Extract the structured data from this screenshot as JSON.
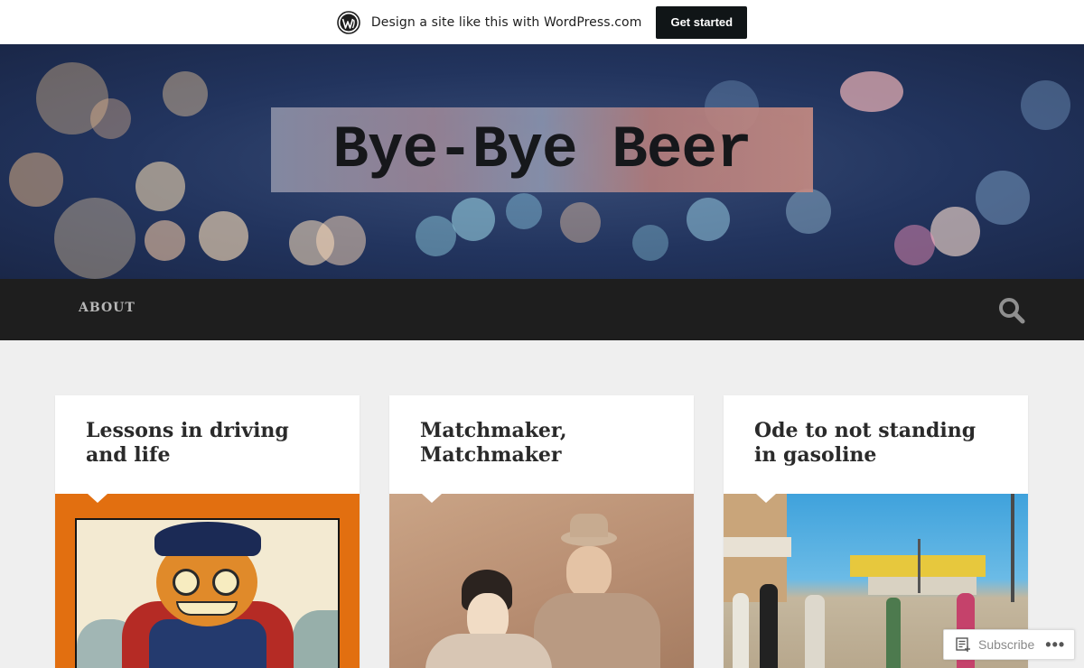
{
  "promo": {
    "text": "Design a site like this with WordPress.com",
    "button_label": "Get started"
  },
  "site": {
    "title": "Bye-Bye Beer"
  },
  "nav": {
    "about_label": "ABOUT"
  },
  "posts": [
    {
      "title": "Lessons in driving and life"
    },
    {
      "title": "Matchmaker, Matchmaker"
    },
    {
      "title": "Ode to not standing in gasoline"
    }
  ],
  "subscribe": {
    "label": "Subscribe",
    "more_label": "•••"
  },
  "colors": {
    "nav_bg": "#1e1e1e",
    "page_bg": "#efefef",
    "promo_button": "#101517"
  },
  "icons": [
    "wordpress-logo-icon",
    "search-icon",
    "subscribe-icon",
    "more-icon"
  ]
}
